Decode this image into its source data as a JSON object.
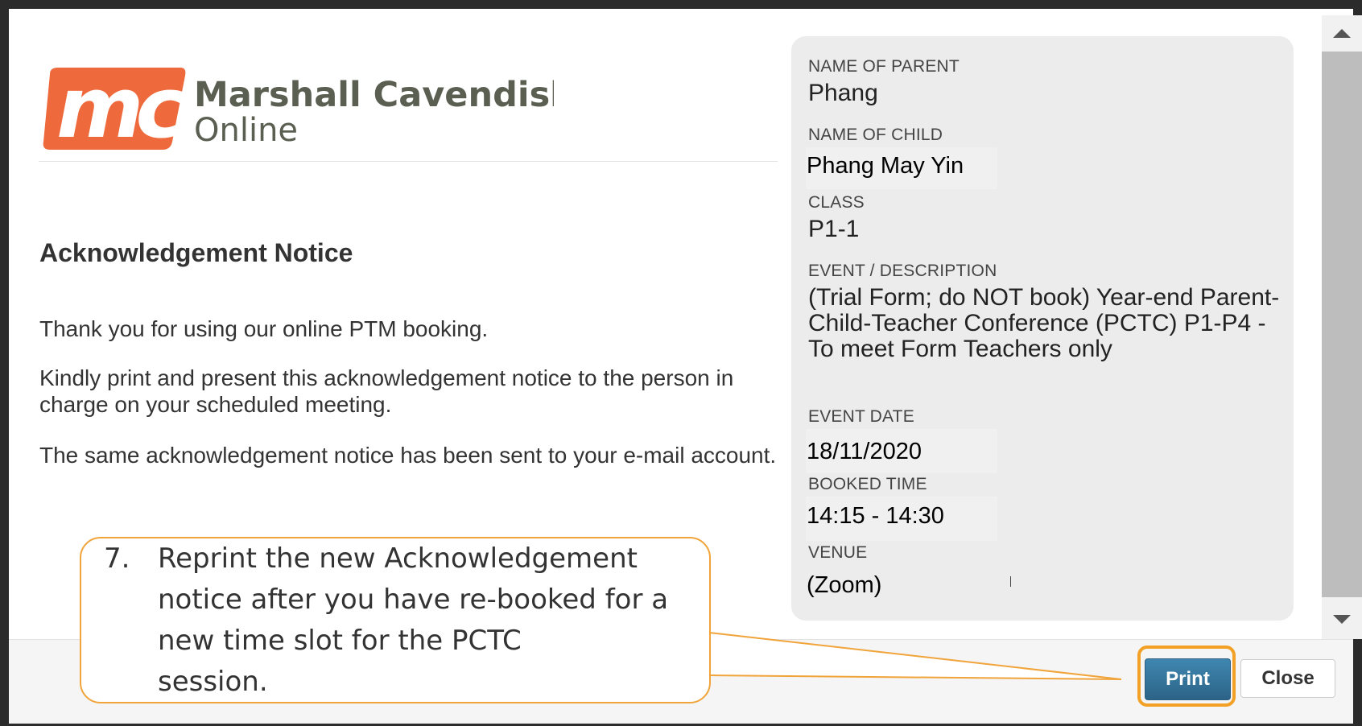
{
  "logo": {
    "monogram": "mc",
    "line1": "Marshall Cavendish",
    "line2": "Online",
    "brand_color": "#ee6a3c",
    "text_color": "#5b5f52"
  },
  "notice": {
    "heading": "Acknowledgement Notice",
    "paragraphs": [
      "Thank you for using our online PTM booking.",
      "Kindly print and present this acknowledgement notice to the person in charge on your scheduled meeting.",
      "The same acknowledgement notice has been sent to your e-mail account."
    ]
  },
  "details": {
    "parent_label": "NAME OF PARENT",
    "parent_value": "Phang",
    "child_label": "NAME OF CHILD",
    "child_value": "Phang May Yin",
    "class_label": "CLASS",
    "class_value": "P1-1",
    "event_label": "EVENT / DESCRIPTION",
    "event_value": "(Trial Form; do NOT book) Year-end Parent-Child-Teacher Conference (PCTC) P1-P4 - To meet Form Teachers only",
    "date_label": "EVENT DATE",
    "date_value": "18/11/2020",
    "time_label": "BOOKED TIME",
    "time_value": "14:15 - 14:30",
    "venue_label": "VENUE",
    "venue_value": "(Zoom)"
  },
  "footer": {
    "print_label": "Print",
    "close_label": "Close",
    "print_color": "#337299",
    "highlight_color": "#f2a026"
  },
  "callout": {
    "number": "7.",
    "text": "Reprint the new Acknowledgement\nnotice after you have re-booked for a\nnew time slot for the PCTC\nsession.",
    "border_color": "#f0a43a"
  }
}
